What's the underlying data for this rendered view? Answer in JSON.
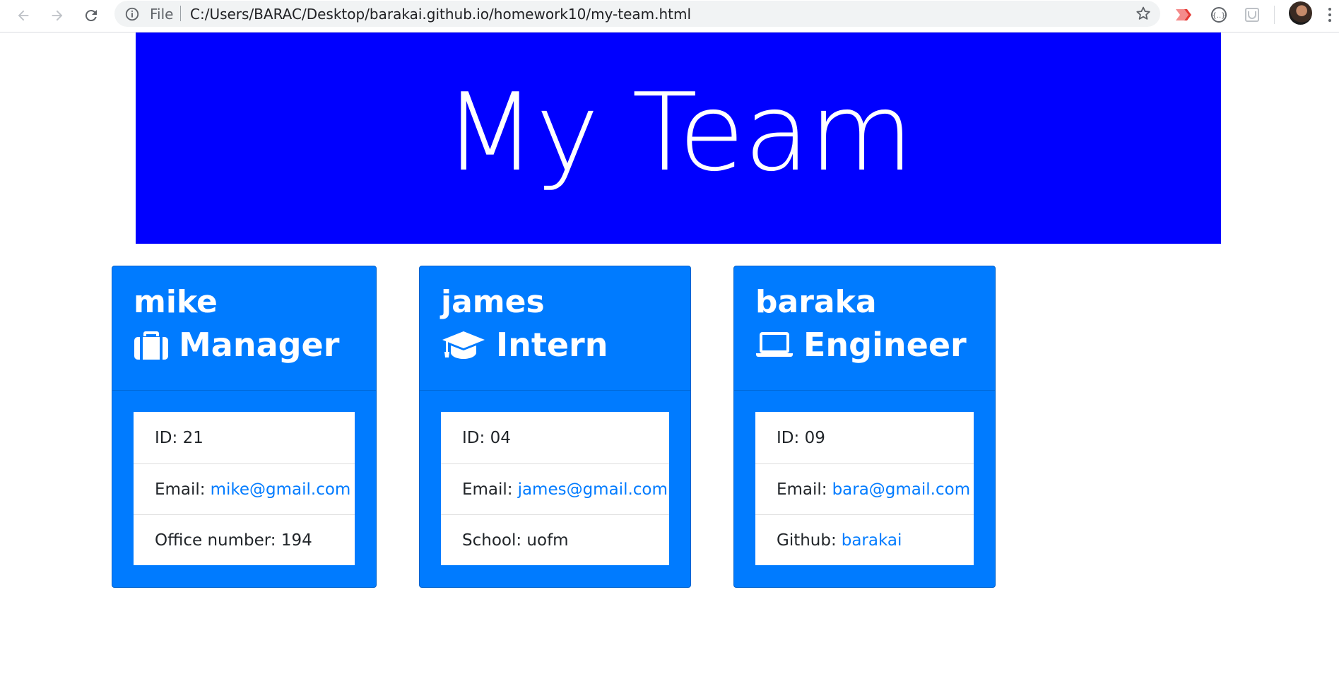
{
  "browser": {
    "scheme_label": "File",
    "url": "C:/Users/BARAC/Desktop/barakai.github.io/homework10/my-team.html"
  },
  "page": {
    "title": "My Team",
    "accent_color": "#0000ff",
    "card_color": "#007bff",
    "link_color": "#007bff"
  },
  "team": [
    {
      "name": "mike",
      "role": "Manager",
      "icon": "briefcase-icon",
      "id_label": "ID:",
      "id": "21",
      "email_label": "Email:",
      "email": "mike@gmail.com",
      "extra_label": "Office number:",
      "extra": "194"
    },
    {
      "name": "james",
      "role": "Intern",
      "icon": "graduation-cap-icon",
      "id_label": "ID:",
      "id": "04",
      "email_label": "Email:",
      "email": "james@gmail.com",
      "extra_label": "School:",
      "extra": "uofm"
    },
    {
      "name": "baraka",
      "role": "Engineer",
      "icon": "laptop-icon",
      "id_label": "ID:",
      "id": "09",
      "email_label": "Email:",
      "email": "bara@gmail.com",
      "extra_label": "Github:",
      "extra": "barakai"
    }
  ]
}
